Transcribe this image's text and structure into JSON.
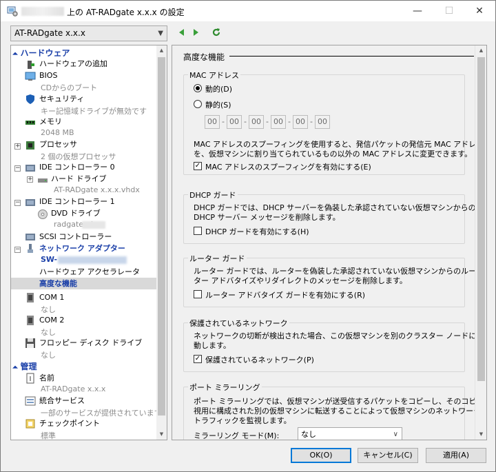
{
  "window": {
    "title": "上の AT-RADgate x.x.x の設定",
    "minimize": "—",
    "maximize": "☐",
    "close": "✕"
  },
  "vm_select": {
    "value": "AT-RADgate x.x.x"
  },
  "tree": {
    "hardware_header": "ハードウェア",
    "management_header": "管理",
    "items": [
      {
        "label": "ハードウェアの追加"
      },
      {
        "label": "BIOS",
        "sub": "CDからのブート"
      },
      {
        "label": "セキュリティ",
        "sub": "キー記憶域ドライブが無効です"
      },
      {
        "label": "メモリ",
        "sub": "2048 MB"
      },
      {
        "label": "プロセッサ",
        "sub": "2 個の仮想プロセッサ"
      },
      {
        "label": "IDE コントローラー 0"
      },
      {
        "label": "ハード ドライブ",
        "sub": "AT-RADgate x.x.x.vhdx"
      },
      {
        "label": "IDE コントローラー 1"
      },
      {
        "label": "DVD ドライブ",
        "sub": "radgate-        .iso"
      },
      {
        "label": "SCSI コントローラー"
      },
      {
        "label": "ネットワーク アダプター",
        "sub": "SW-"
      },
      {
        "label": "ハードウェア アクセラレータ"
      },
      {
        "label": "高度な機能"
      },
      {
        "label": "COM 1",
        "sub": "なし"
      },
      {
        "label": "COM 2",
        "sub": "なし"
      },
      {
        "label": "フロッピー ディスク ドライブ",
        "sub": "なし"
      },
      {
        "label": "名前",
        "sub": "AT-RADgate x.x.x"
      },
      {
        "label": "統合サービス",
        "sub": "一部のサービスが提供されています"
      },
      {
        "label": "チェックポイント",
        "sub": "標準"
      }
    ]
  },
  "main": {
    "heading": "高度な機能",
    "mac": {
      "title": "MAC アドレス",
      "dynamic": "動的(D)",
      "static": "静的(S)",
      "octets": [
        "00",
        "00",
        "00",
        "00",
        "00",
        "00"
      ],
      "sep": "-",
      "desc1": "MAC アドレスのスプーフィングを使用すると、発信パケットの発信元 MAC アドレス",
      "desc2": "を、仮想マシンに割り当てられているもの以外の MAC アドレスに変更できます。",
      "spoof": "MAC アドレスのスプーフィングを有効にする(E)"
    },
    "dhcp": {
      "title": "DHCP ガード",
      "desc1": "DHCP ガードでは、DHCP サーバーを偽装した承認されていない仮想マシンからの",
      "desc2": "DHCP サーバー メッセージを削除します。",
      "check": "DHCP ガードを有効にする(H)"
    },
    "router": {
      "title": "ルーター ガード",
      "desc1": "ルーター ガードでは、ルーターを偽装した承認されていない仮想マシンからのルー",
      "desc2": "ター アドバタイズやリダイレクトのメッセージを削除します。",
      "check": "ルーター アドバタイズ ガードを有効にする(R)"
    },
    "protected": {
      "title": "保護されているネットワーク",
      "desc1": "ネットワークの切断が検出された場合、この仮想マシンを別のクラスター ノードに移",
      "desc2": "動します。",
      "check": "保護されているネットワーク(P)"
    },
    "mirror": {
      "title": "ポート ミラーリング",
      "desc1": "ポート ミラーリングでは、仮想マシンが送受信するパケットをコピーし、そのコピーを監",
      "desc2": "視用に構成された別の仮想マシンに転送することによって仮想マシンのネットワーク",
      "desc3": "トラフィックを監視します。",
      "mode_label": "ミラーリング モード(M):",
      "mode_value": "なし"
    }
  },
  "buttons": {
    "ok": "OK(O)",
    "cancel": "キャンセル(C)",
    "apply": "適用(A)"
  },
  "colors": {
    "section": "#1a3fa8",
    "selected": "#d9d9d9",
    "default_border": "#0078d7"
  }
}
